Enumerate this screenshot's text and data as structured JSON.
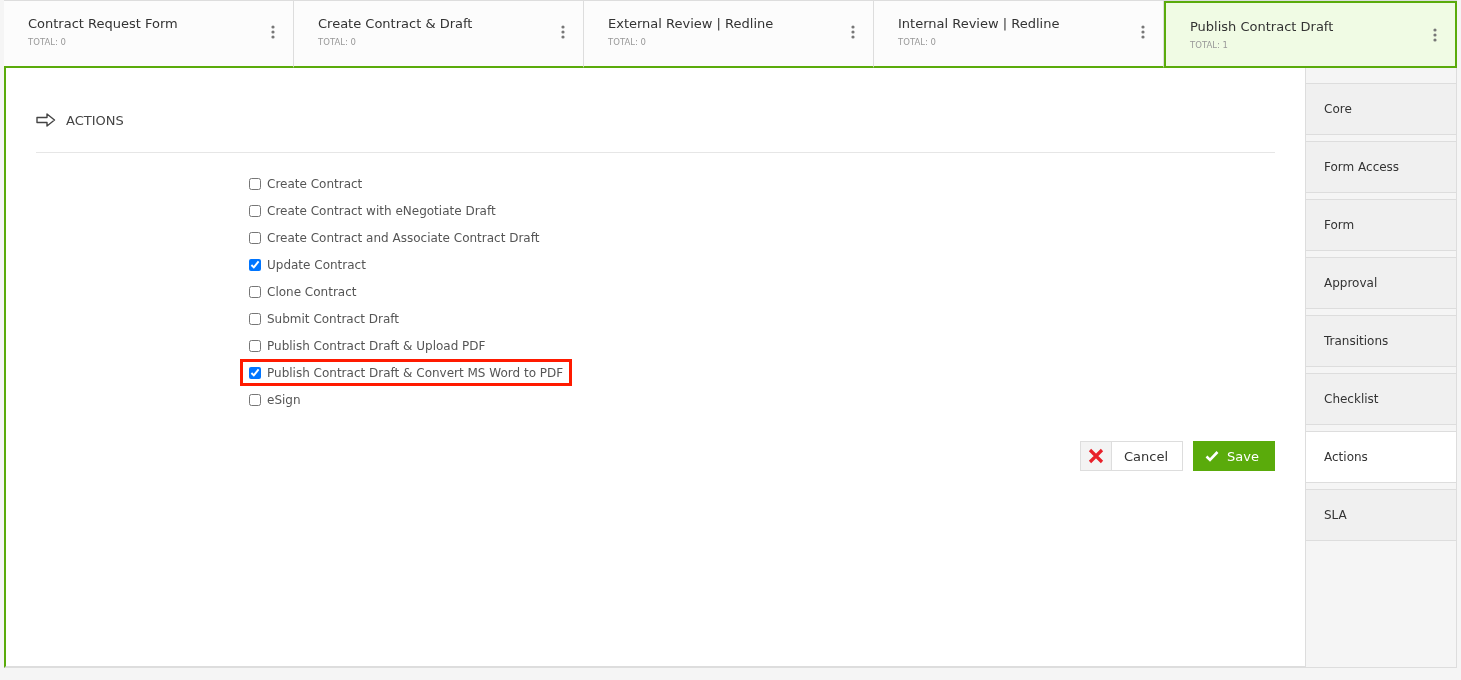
{
  "stages": [
    {
      "title": "Contract Request Form",
      "total": "TOTAL: 0",
      "selected": false
    },
    {
      "title": "Create Contract & Draft",
      "total": "TOTAL: 0",
      "selected": false
    },
    {
      "title": "External Review | Redline",
      "total": "TOTAL: 0",
      "selected": false
    },
    {
      "title": "Internal Review | Redline",
      "total": "TOTAL: 0",
      "selected": false
    },
    {
      "title": "Publish Contract Draft",
      "total": "TOTAL: 1",
      "selected": true
    }
  ],
  "section": {
    "title": "ACTIONS"
  },
  "actions": [
    {
      "label": "Create Contract",
      "checked": false,
      "highlighted": false
    },
    {
      "label": "Create Contract with eNegotiate Draft",
      "checked": false,
      "highlighted": false
    },
    {
      "label": "Create Contract and Associate Contract Draft",
      "checked": false,
      "highlighted": false
    },
    {
      "label": "Update Contract",
      "checked": true,
      "highlighted": false
    },
    {
      "label": "Clone Contract",
      "checked": false,
      "highlighted": false
    },
    {
      "label": "Submit Contract Draft",
      "checked": false,
      "highlighted": false
    },
    {
      "label": "Publish Contract Draft & Upload PDF",
      "checked": false,
      "highlighted": false
    },
    {
      "label": "Publish Contract Draft & Convert MS Word to PDF",
      "checked": true,
      "highlighted": true
    },
    {
      "label": "eSign",
      "checked": false,
      "highlighted": false
    }
  ],
  "buttons": {
    "cancel": "Cancel",
    "save": "Save"
  },
  "side_tabs": [
    {
      "label": "Core",
      "selected": false
    },
    {
      "label": "Form Access",
      "selected": false
    },
    {
      "label": "Form",
      "selected": false
    },
    {
      "label": "Approval",
      "selected": false
    },
    {
      "label": "Transitions",
      "selected": false
    },
    {
      "label": "Checklist",
      "selected": false
    },
    {
      "label": "Actions",
      "selected": true
    },
    {
      "label": "SLA",
      "selected": false
    }
  ]
}
